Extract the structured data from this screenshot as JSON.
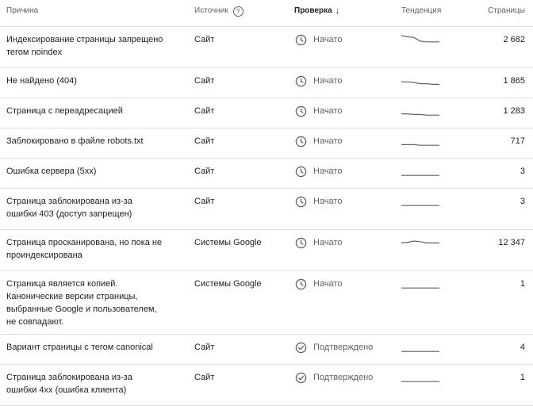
{
  "columns": {
    "reason": "Причина",
    "source": "Источник",
    "check": "Проверка",
    "trend": "Тенденция",
    "pages": "Страницы"
  },
  "rows": [
    {
      "reason": "Индексирование страницы запрещено тегом noindex",
      "source": "Сайт",
      "status": "Начато",
      "status_type": "started",
      "pages": "2 682",
      "trend": [
        0.95,
        0.85,
        0.8,
        0.5,
        0.45,
        0.45,
        0.45
      ]
    },
    {
      "reason": "Не найдено (404)",
      "source": "Сайт",
      "status": "Начато",
      "status_type": "started",
      "pages": "1 865",
      "trend": [
        0.55,
        0.55,
        0.5,
        0.4,
        0.4,
        0.35,
        0.35
      ]
    },
    {
      "reason": "Страница с переадресацией",
      "source": "Сайт",
      "status": "Начато",
      "status_type": "started",
      "pages": "1 283",
      "trend": [
        0.4,
        0.4,
        0.35,
        0.35,
        0.3,
        0.3,
        0.3
      ]
    },
    {
      "reason": "Заблокировано в файле robots.txt",
      "source": "Сайт",
      "status": "Начато",
      "status_type": "started",
      "pages": "717",
      "trend": [
        0.35,
        0.35,
        0.35,
        0.3,
        0.3,
        0.3,
        0.3
      ]
    },
    {
      "reason": "Ошибка сервера (5xx)",
      "source": "Сайт",
      "status": "Начато",
      "status_type": "started",
      "pages": "3",
      "trend": [
        0.3,
        0.3,
        0.3,
        0.3,
        0.3,
        0.3,
        0.3
      ]
    },
    {
      "reason": "Страница заблокирована из-за ошибки 403 (доступ запрещен)",
      "source": "Сайт",
      "status": "Начато",
      "status_type": "started",
      "pages": "3",
      "trend": [
        0.3,
        0.3,
        0.3,
        0.3,
        0.3,
        0.3,
        0.3
      ]
    },
    {
      "reason": "Страница просканирована, но пока не проиндексирована",
      "source": "Системы Google",
      "status": "Начато",
      "status_type": "started",
      "pages": "12 347",
      "trend": [
        0.6,
        0.65,
        0.75,
        0.7,
        0.6,
        0.6,
        0.6
      ]
    },
    {
      "reason": "Страница является копией. Канонические версии страницы, выбранные Google и пользователем, не совпадают.",
      "source": "Системы Google",
      "status": "Начато",
      "status_type": "started",
      "pages": "1",
      "trend": [
        0.3,
        0.3,
        0.3,
        0.3,
        0.3,
        0.3,
        0.3
      ]
    },
    {
      "reason": "Вариант страницы с тегом canonical",
      "source": "Сайт",
      "status": "Подтверждено",
      "status_type": "confirmed",
      "pages": "4",
      "trend": [
        0.3,
        0.3,
        0.3,
        0.3,
        0.3,
        0.3,
        0.3
      ]
    },
    {
      "reason": "Страница заблокирована из-за ошибки 4xx (ошибка клиента)",
      "source": "Сайт",
      "status": "Подтверждено",
      "status_type": "confirmed",
      "pages": "1",
      "trend": [
        0.3,
        0.3,
        0.3,
        0.3,
        0.3,
        0.3,
        0.3
      ]
    }
  ]
}
